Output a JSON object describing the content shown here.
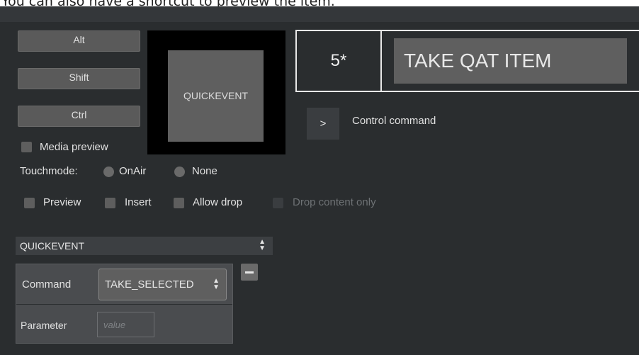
{
  "caption": {
    "text": "You can also have a shortcut to preview the item."
  },
  "modifiers": {
    "alt": "Alt",
    "shift": "Shift",
    "ctrl": "Ctrl"
  },
  "preview_tile": {
    "label": "QUICKEVENT"
  },
  "media_preview": {
    "label": "Media preview",
    "checked": false
  },
  "touchmode": {
    "label": "Touchmode:",
    "options": [
      "OnAir",
      "None"
    ]
  },
  "options": {
    "preview": "Preview",
    "insert": "Insert",
    "allow_drop": "Allow drop",
    "drop_content_only": "Drop content only"
  },
  "shortcut": {
    "key": "5*",
    "command": "TAKE QAT ITEM"
  },
  "control_command": {
    "arrow": ">",
    "label": "Control command"
  },
  "event_select": {
    "value": "QUICKEVENT"
  },
  "command_table": {
    "command_label": "Command",
    "command_value": "TAKE_SELECTED",
    "parameter_label": "Parameter",
    "parameter_placeholder": "value"
  },
  "colors": {
    "panel_bg": "#2a2d2f",
    "button_bg": "#5a5a5a",
    "text": "#e6e6e6",
    "key_border": "#e8e8e8"
  }
}
